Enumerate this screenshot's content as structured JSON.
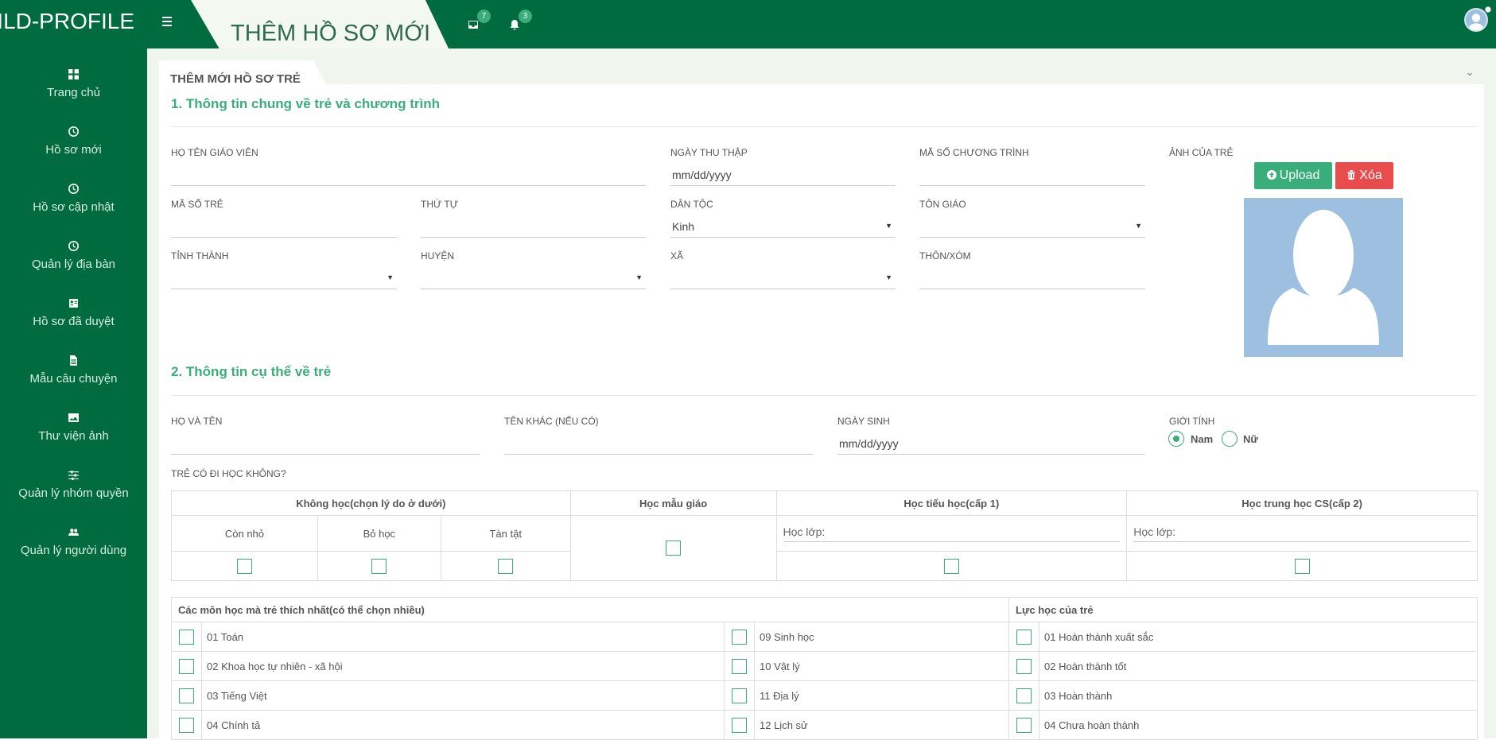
{
  "app": {
    "brand": "CHILD-PROFILE",
    "page_title": "THÊM HỒ SƠ MỚI"
  },
  "topbar": {
    "messages_count": "7",
    "notifications_count": "3"
  },
  "sidebar": {
    "items": [
      {
        "label": "Trang chủ",
        "icon": "dashboard-icon"
      },
      {
        "label": "Hồ sơ mới",
        "icon": "clock-icon"
      },
      {
        "label": "Hồ sơ cập nhật",
        "icon": "clock-icon"
      },
      {
        "label": "Quản lý địa bàn",
        "icon": "clock-icon"
      },
      {
        "label": "Hồ sơ đã duyệt",
        "icon": "id-card-icon"
      },
      {
        "label": "Mẫu câu chuyện",
        "icon": "document-icon"
      },
      {
        "label": "Thư viện ảnh",
        "icon": "image-icon"
      },
      {
        "label": "Quản lý nhóm quyền",
        "icon": "sliders-icon"
      },
      {
        "label": "Quản lý người dùng",
        "icon": "users-icon"
      }
    ]
  },
  "panel": {
    "title": "THÊM MỚI HỒ SƠ TRẺ"
  },
  "section1": {
    "title": "1. Thông tin chung về trẻ và chương trình",
    "teacher_label": "Họ tên giáo viên",
    "collect_date_label": "Ngày thu thập",
    "collect_date_value": "mm/dd/yyyy",
    "program_code_label": "Mã số chương trình",
    "child_code_label": "Mã số trẻ",
    "order_label": "Thứ tự",
    "ethnic_label": "Dân tộc",
    "ethnic_value": "Kinh",
    "religion_label": "Tôn giáo",
    "province_label": "Tỉnh thành",
    "district_label": "Huyện",
    "commune_label": "Xã",
    "village_label": "Thôn/xóm",
    "photo_label": "Ảnh của trẻ",
    "upload_label": "Upload",
    "delete_label": "Xóa"
  },
  "section2": {
    "title": "2. Thông tin cụ thể về trẻ",
    "fullname_label": "Họ và tên",
    "othername_label": "Tên khác (nếu có)",
    "dob_label": "Ngày sinh",
    "dob_value": "mm/dd/yyyy",
    "gender_label": "Giới tính",
    "gender_male": "Nam",
    "gender_female": "Nữ",
    "school_question": "Trẻ có đi học không?"
  },
  "school_table": {
    "no_school": "Không học(chọn lý do ở dưới)",
    "kindergarten": "Học mẫu giáo",
    "primary": "Học tiểu học(cấp 1)",
    "secondary": "Học trung học CS(cấp 2)",
    "reason_young": "Còn nhỏ",
    "reason_dropout": "Bỏ học",
    "reason_disabled": "Tàn tật",
    "grade_placeholder": "Học lớp:"
  },
  "subjects": {
    "header": "Các môn học mà trẻ thích nhất(có thể chọn nhiều)",
    "left": [
      "01 Toán",
      "02 Khoa học tự nhiên - xã hội",
      "03 Tiếng Việt",
      "04 Chính tả"
    ],
    "right": [
      "09 Sinh học",
      "10 Vật lý",
      "11 Địa lý",
      "12 Lịch sử"
    ]
  },
  "performance": {
    "header": "Lực học của trẻ",
    "items": [
      "01 Hoàn thành xuất sắc",
      "02 Hoàn thành tốt",
      "03 Hoàn thành",
      "04 Chưa hoàn thành"
    ]
  },
  "colors": {
    "primary": "#006b3f",
    "accent": "#3aae7a",
    "danger": "#e84c4c"
  }
}
